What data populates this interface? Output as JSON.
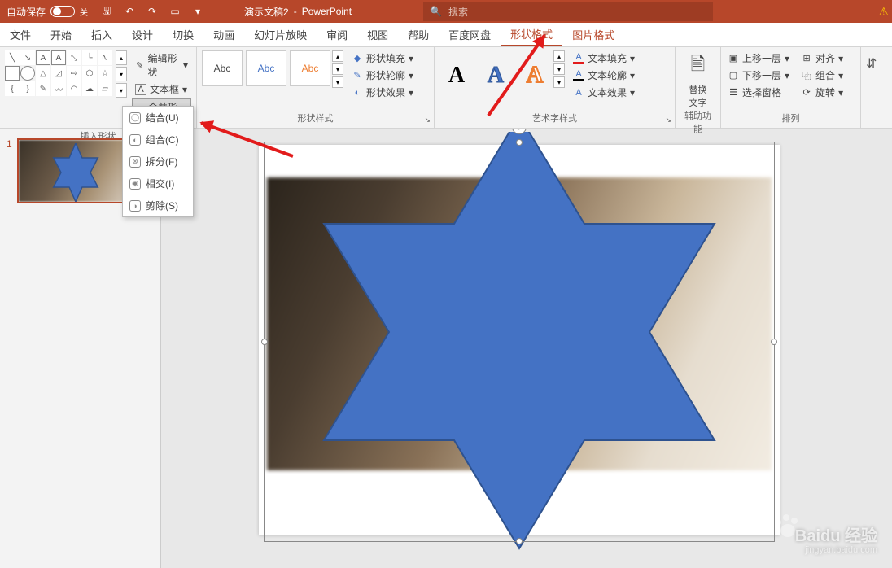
{
  "titlebar": {
    "autosave_label": "自动保存",
    "autosave_state": "关",
    "doc_name": "演示文稿2",
    "app_name": "PowerPoint",
    "search_placeholder": "搜索"
  },
  "tabs": {
    "file": "文件",
    "home": "开始",
    "insert": "插入",
    "design": "设计",
    "transitions": "切换",
    "animations": "动画",
    "slideshow": "幻灯片放映",
    "review": "审阅",
    "view": "视图",
    "help": "帮助",
    "baidu": "百度网盘",
    "shape_format": "形状格式",
    "picture_format": "图片格式"
  },
  "ribbon": {
    "insert_shapes": {
      "label": "插入形状",
      "edit_shape": "编辑形状",
      "text_box": "文本框",
      "merge_shapes": "合并形状"
    },
    "shape_styles": {
      "label": "形状样式",
      "preset": "Abc",
      "fill": "形状填充",
      "outline": "形状轮廓",
      "effects": "形状效果"
    },
    "wordart_styles": {
      "label": "艺术字样式",
      "sample": "A",
      "text_fill": "文本填充",
      "text_outline": "文本轮廓",
      "text_effects": "文本效果"
    },
    "accessibility": {
      "label": "辅助功能",
      "alt_text": "替换\n文字"
    },
    "arrange": {
      "label": "排列",
      "bring_forward": "上移一层",
      "send_backward": "下移一层",
      "selection_pane": "选择窗格",
      "align": "对齐",
      "group": "组合",
      "rotate": "旋转"
    }
  },
  "dropdown": {
    "union": "结合(U)",
    "combine": "组合(C)",
    "fragment": "拆分(F)",
    "intersect": "相交(I)",
    "subtract": "剪除(S)"
  },
  "thumb": {
    "number": "1"
  },
  "watermark": {
    "brand": "Baidu 经验",
    "url": "jingyan.baidu.com"
  }
}
